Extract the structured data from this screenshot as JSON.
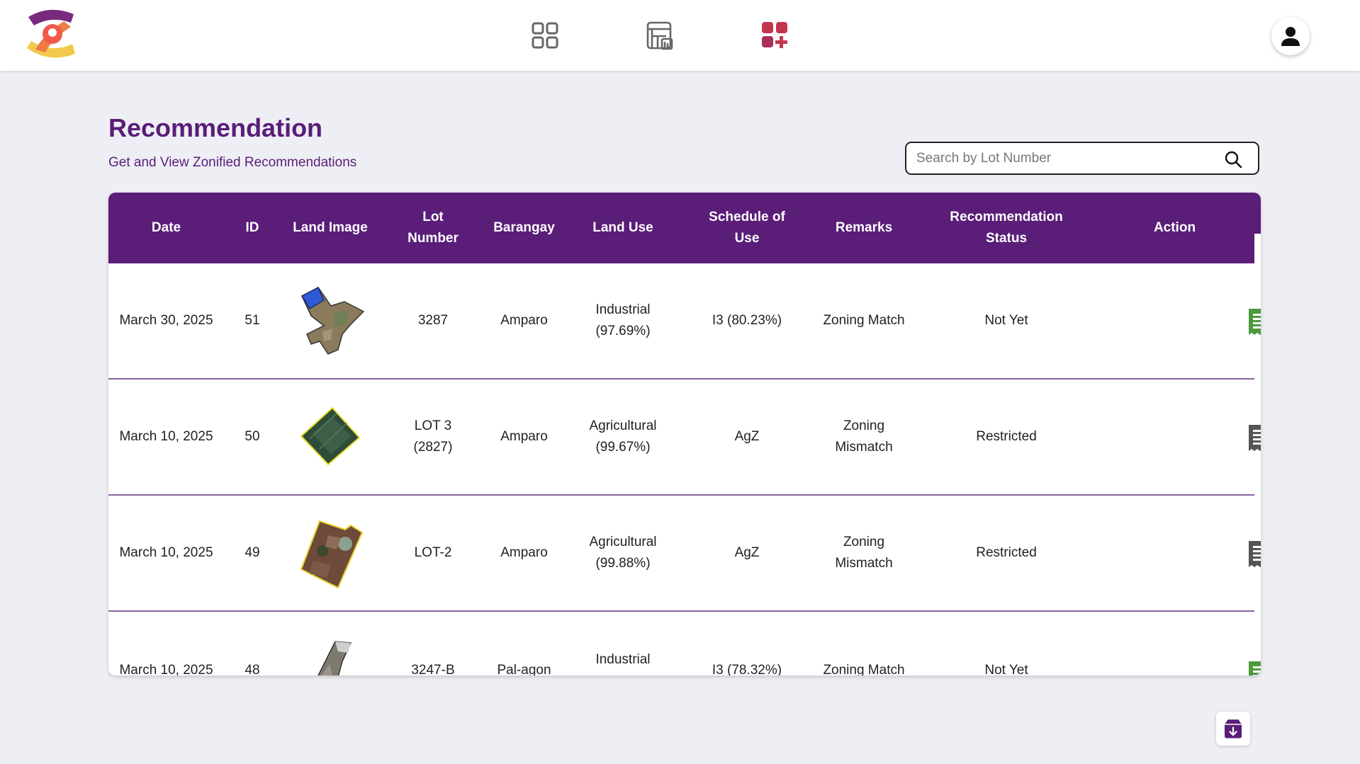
{
  "nav": {
    "logo": "zonify-logo",
    "icons": [
      "dashboard-grid-icon",
      "map-icon",
      "add-apps-icon"
    ],
    "avatar": "user-avatar-icon"
  },
  "header": {
    "title": "Recommendation",
    "subtitle": "Get and View Zonified Recommendations"
  },
  "search": {
    "placeholder": "Search by Lot Number"
  },
  "table": {
    "columns": {
      "date": "Date",
      "id": "ID",
      "land_image": "Land Image",
      "lot_number": "Lot Number",
      "barangay": "Barangay",
      "land_use": "Land Use",
      "schedule_of_use": "Schedule of Use",
      "remarks": "Remarks",
      "recommendation_status": "Recommendation Status",
      "action": "Action"
    },
    "rows": [
      {
        "date": "March 30, 2025",
        "id": "51",
        "lot_number": "3287",
        "barangay": "Amparo",
        "land_use": "Industrial (97.69%)",
        "schedule_of_use": "I3 (80.23%)",
        "remarks": "Zoning Match",
        "status": "Not Yet",
        "doc_icon_color": "#4c9a3c"
      },
      {
        "date": "March 10, 2025",
        "id": "50",
        "lot_number": "LOT 3 (2827)",
        "barangay": "Amparo",
        "land_use": "Agricultural (99.67%)",
        "schedule_of_use": "AgZ",
        "remarks": "Zoning Mismatch",
        "status": "Restricted",
        "doc_icon_color": "#555555"
      },
      {
        "date": "March 10, 2025",
        "id": "49",
        "lot_number": "LOT-2",
        "barangay": "Amparo",
        "land_use": "Agricultural (99.88%)",
        "schedule_of_use": "AgZ",
        "remarks": "Zoning Mismatch",
        "status": "Restricted",
        "doc_icon_color": "#555555"
      },
      {
        "date": "March 10, 2025",
        "id": "48",
        "lot_number": "3247-B",
        "barangay": "Pal-agon",
        "land_use": "Industrial",
        "schedule_of_use": "I3 (78.32%)",
        "remarks": "Zoning Match",
        "status": "Not Yet",
        "doc_icon_color": "#4c9a3c"
      }
    ]
  },
  "colors": {
    "primary": "#5a1d78",
    "download_red": "#d9322a",
    "doc_green": "#4c9a3c",
    "doc_gray": "#555555"
  },
  "actions": {
    "doc_icon": "document-icon",
    "download_icon": "download-archive-icon",
    "export_icon": "export-archive-icon"
  }
}
